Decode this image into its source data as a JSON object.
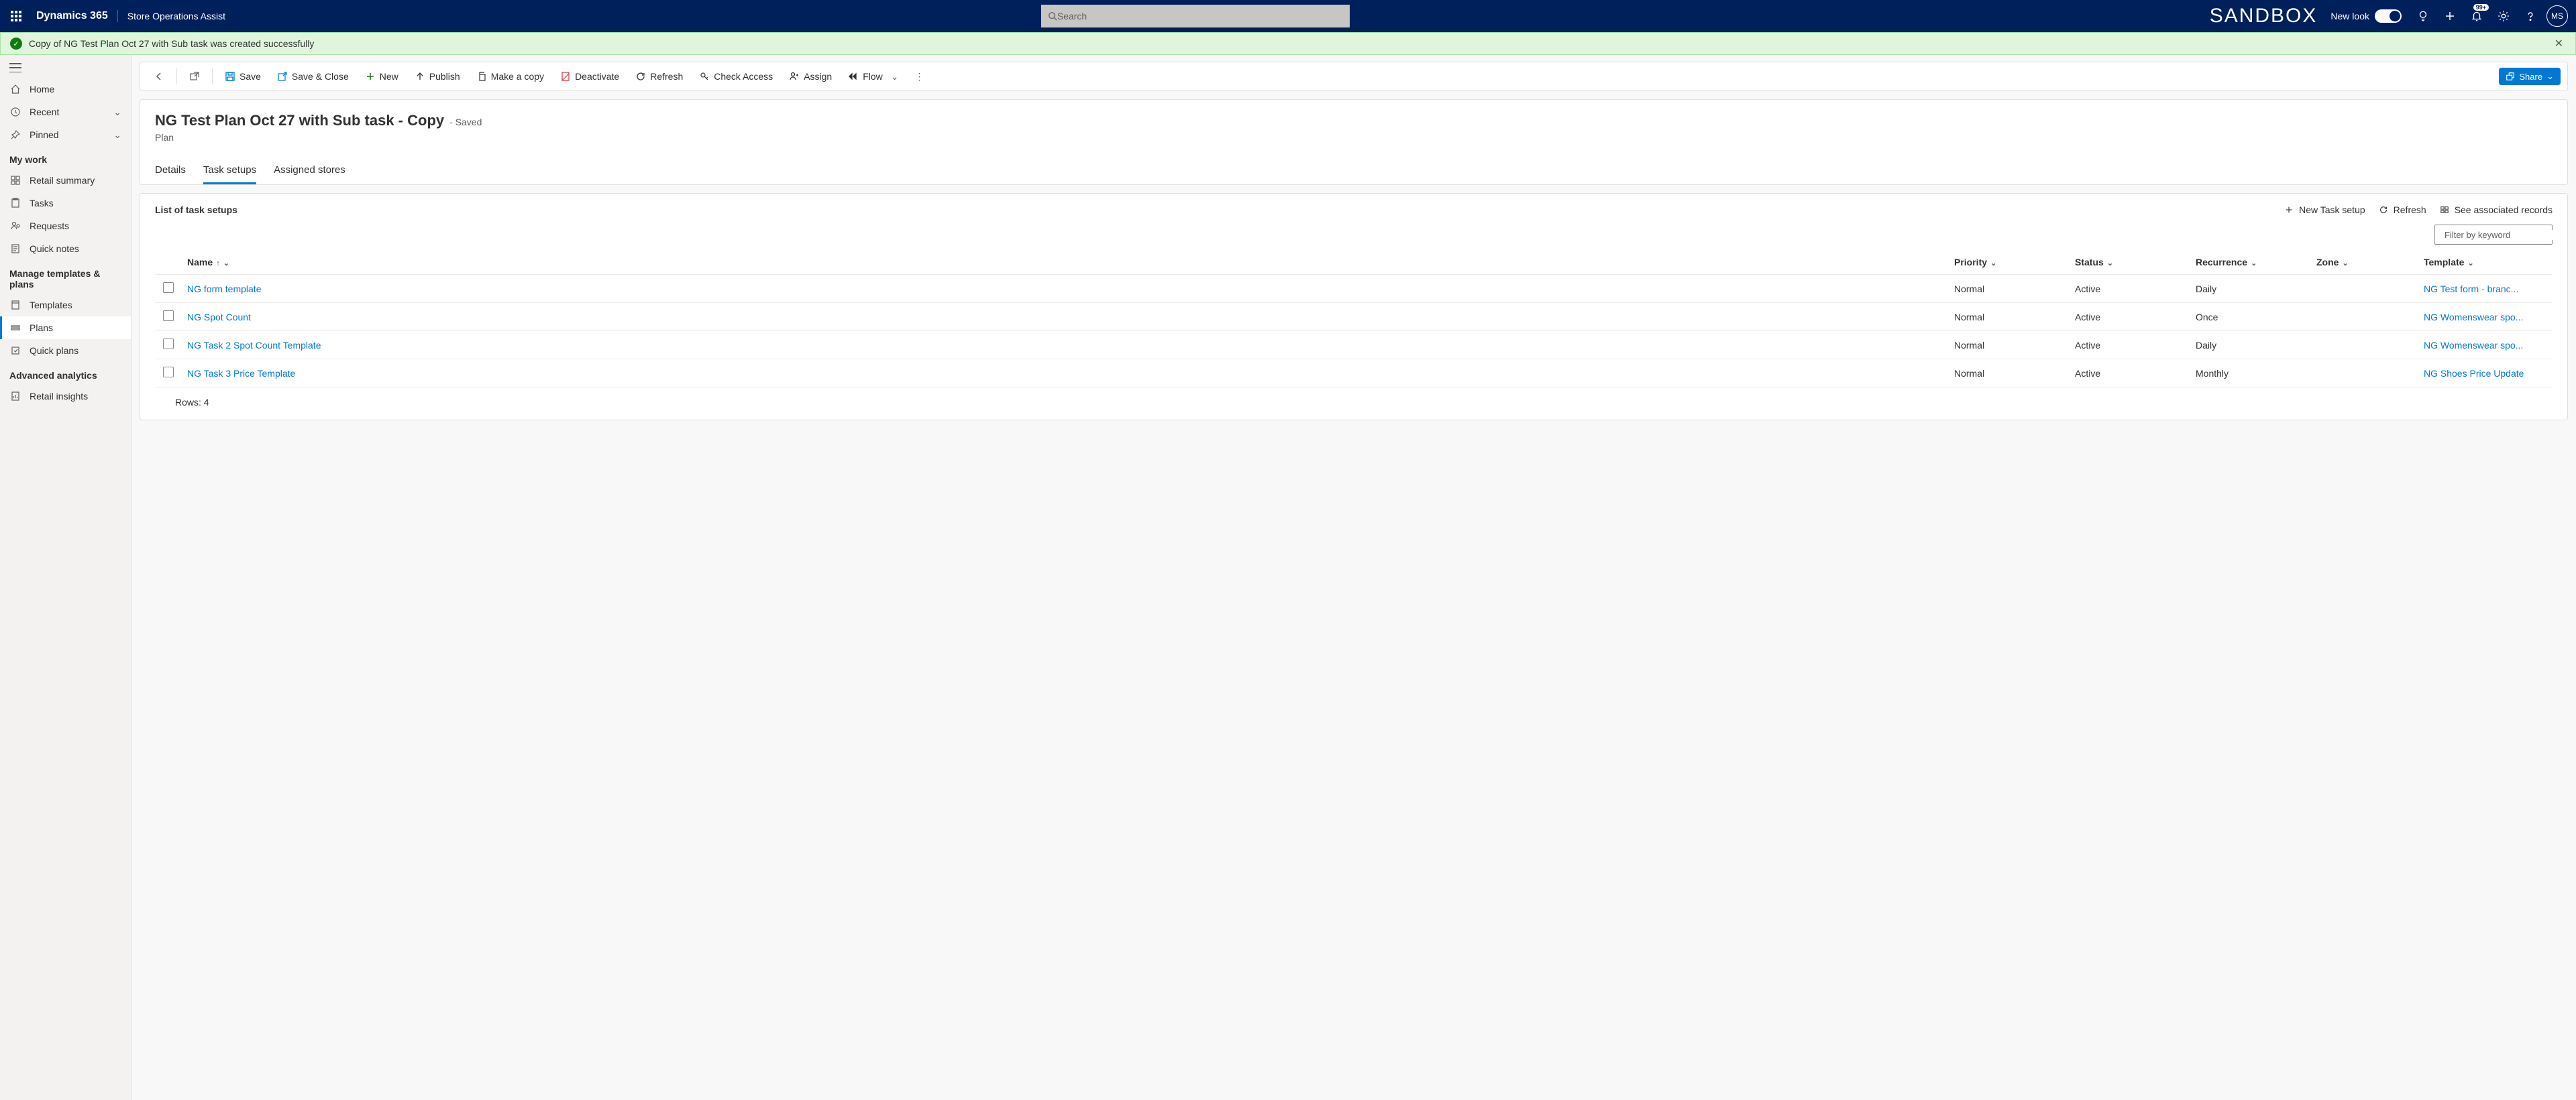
{
  "topbar": {
    "brand": "Dynamics 365",
    "app": "Store Operations Assist",
    "search_placeholder": "Search",
    "sandbox": "SANDBOX",
    "newlook_label": "New look",
    "badge": "99+",
    "avatar": "MS"
  },
  "notif": {
    "text": "Copy of NG Test Plan Oct 27 with Sub task was created successfully"
  },
  "sidebar": {
    "home": "Home",
    "recent": "Recent",
    "pinned": "Pinned",
    "s1": "My work",
    "retail_summary": "Retail summary",
    "tasks": "Tasks",
    "requests": "Requests",
    "quick_notes": "Quick notes",
    "s2": "Manage templates & plans",
    "templates": "Templates",
    "plans": "Plans",
    "quick_plans": "Quick plans",
    "s3": "Advanced analytics",
    "retail_insights": "Retail insights"
  },
  "cmd": {
    "save": "Save",
    "save_close": "Save & Close",
    "new": "New",
    "publish": "Publish",
    "copy": "Make a copy",
    "deactivate": "Deactivate",
    "refresh": "Refresh",
    "check_access": "Check Access",
    "assign": "Assign",
    "flow": "Flow",
    "share": "Share"
  },
  "page": {
    "title": "NG Test Plan Oct 27 with Sub task - Copy",
    "saved": "- Saved",
    "entity": "Plan",
    "tabs": {
      "details": "Details",
      "task_setups": "Task setups",
      "assigned": "Assigned stores"
    }
  },
  "grid": {
    "title": "List of task setups",
    "new": "New Task setup",
    "refresh": "Refresh",
    "associated": "See associated records",
    "filter_placeholder": "Filter by keyword",
    "cols": {
      "name": "Name",
      "priority": "Priority",
      "status": "Status",
      "recurrence": "Recurrence",
      "zone": "Zone",
      "template": "Template"
    },
    "rows": [
      {
        "name": "NG form template",
        "priority": "Normal",
        "status": "Active",
        "recurrence": "Daily",
        "zone": "",
        "template": "NG Test form - branc..."
      },
      {
        "name": "NG Spot Count",
        "priority": "Normal",
        "status": "Active",
        "recurrence": "Once",
        "zone": "",
        "template": "NG Womenswear spo..."
      },
      {
        "name": "NG Task 2 Spot Count Template",
        "priority": "Normal",
        "status": "Active",
        "recurrence": "Daily",
        "zone": "",
        "template": "NG Womenswear spo..."
      },
      {
        "name": "NG Task 3 Price Template",
        "priority": "Normal",
        "status": "Active",
        "recurrence": "Monthly",
        "zone": "",
        "template": "NG Shoes Price Update"
      }
    ],
    "row_count": "Rows: 4"
  }
}
